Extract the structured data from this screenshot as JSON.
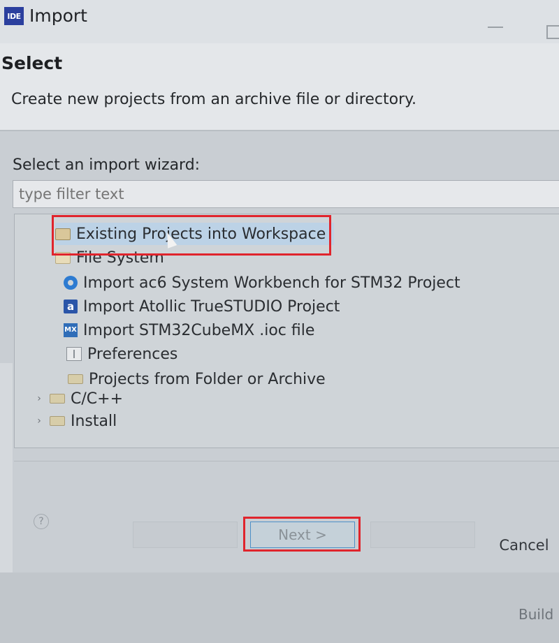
{
  "window": {
    "app_icon_text": "IDE",
    "title": "Import"
  },
  "header": {
    "title": "Select",
    "description": "Create new projects from an archive file or directory."
  },
  "wizard": {
    "label": "Select an import wizard:",
    "filter_placeholder": "type filter text",
    "items": [
      {
        "label": "Existing Projects into Workspace",
        "icon": "existing-projects-icon",
        "selected": true
      },
      {
        "label": "File System",
        "icon": "folder-icon"
      },
      {
        "label": "Import ac6 System Workbench for STM32 Project",
        "icon": "ac6-icon"
      },
      {
        "label": "Import Atollic TrueSTUDIO Project",
        "icon": "atollic-icon"
      },
      {
        "label": "Import STM32CubeMX .ioc file",
        "icon": "stm32cubemx-icon"
      },
      {
        "label": "Preferences",
        "icon": "preferences-icon"
      },
      {
        "label": "Projects from Folder or Archive",
        "icon": "folder-icon"
      },
      {
        "label": "C/C++",
        "icon": "folder-icon"
      },
      {
        "label": "Install",
        "icon": "folder-icon"
      }
    ]
  },
  "buttons": {
    "next": "Next >",
    "cancel": "Cancel"
  },
  "status": {
    "build_text": "Build"
  },
  "colors": {
    "highlight_red": "#e0242c",
    "selection_blue": "#bcd2e6"
  }
}
